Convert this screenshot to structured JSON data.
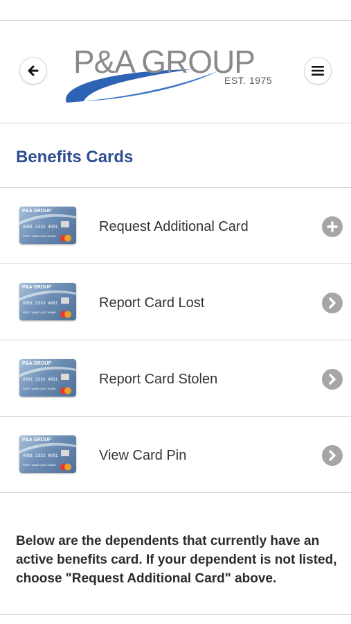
{
  "header": {
    "logo_text": "P&A GROUP",
    "logo_est": "EST. 1975",
    "back_icon": "arrow-left-icon",
    "menu_icon": "hamburger-icon"
  },
  "section": {
    "title": "Benefits Cards"
  },
  "card_thumbnail": {
    "brand": "P&A GROUP",
    "number": "0091 3333 4001",
    "name": "FIRST NAME  LAST NAME"
  },
  "items": [
    {
      "label": "Request Additional Card",
      "icon": "plus-circle-icon"
    },
    {
      "label": "Report Card Lost",
      "icon": "chevron-right-circle-icon"
    },
    {
      "label": "Report Card Stolen",
      "icon": "chevron-right-circle-icon"
    },
    {
      "label": "View Card Pin",
      "icon": "chevron-right-circle-icon"
    }
  ],
  "info_text": "Below are the dependents that currently have an active benefits card. If your dependent is not listed, choose \"Request Additional Card\" above.",
  "colors": {
    "title_blue": "#2f4e92",
    "swoosh_blue": "#2d63b5",
    "icon_gray": "#a6a6a6"
  }
}
